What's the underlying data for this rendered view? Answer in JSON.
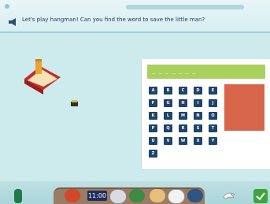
{
  "header": {
    "instruction": "Let's play hangman! Can you find the word to save the little man?",
    "icons": {
      "speaker": "speaker-icon"
    }
  },
  "game": {
    "letters": [
      "A",
      "B",
      "C",
      "D",
      "E",
      "F",
      "G",
      "H",
      "I",
      "J",
      "K",
      "L",
      "M",
      "N",
      "O",
      "P",
      "Q",
      "R",
      "S",
      "T",
      "U",
      "V",
      "W",
      "X",
      "Y",
      "Z"
    ],
    "colors": {
      "key_bg": "#1e4469",
      "word_bar": "#a9d15d",
      "swatch": "#d7654a"
    },
    "art": {
      "hat": "book-and-pen-icon",
      "small": "small-drum-icon"
    }
  },
  "dock": {
    "clock_text": "11:00",
    "icons": [
      "bottle-icon",
      "red-round-icon",
      "clock-icon",
      "headphones-icon",
      "green-bag-icon",
      "notebook-icon",
      "square-icon",
      "bird-icon",
      "checkmark-icon"
    ]
  }
}
